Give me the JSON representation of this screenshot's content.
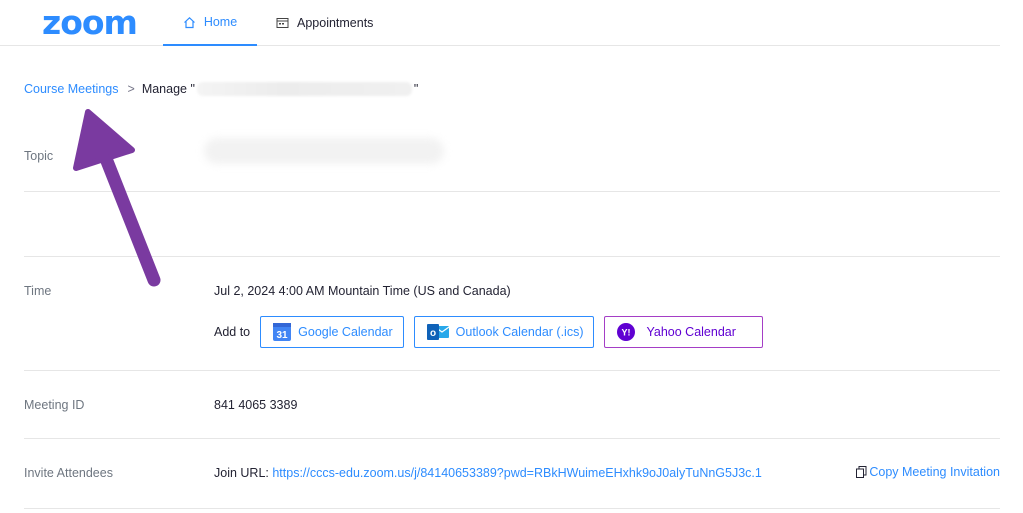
{
  "nav": {
    "logo": "zoom",
    "home": "Home",
    "appointments": "Appointments"
  },
  "breadcrumb": {
    "parent": "Course Meetings",
    "separator": ">",
    "current_prefix": "Manage \"",
    "current_suffix": "\""
  },
  "topic": {
    "label": "Topic"
  },
  "time": {
    "label": "Time",
    "value": "Jul 2, 2024 4:00 AM  Mountain Time (US and Canada)",
    "add_to": "Add to",
    "google": "Google Calendar",
    "google_icon_text": "31",
    "outlook": "Outlook Calendar (.ics)",
    "outlook_icon_text": "o",
    "yahoo": "Yahoo Calendar",
    "yahoo_icon_text": "Y!"
  },
  "meeting_id": {
    "label": "Meeting ID",
    "value": "841 4065 3389"
  },
  "invite": {
    "label": "Invite Attendees",
    "join_label": "Join URL: ",
    "join_url": "https://cccs-edu.zoom.us/j/84140653389?pwd=RBkHWuimeEHxhk9oJ0alyTuNnG5J3c.1",
    "copy": "Copy Meeting Invitation"
  },
  "colors": {
    "accent": "#2d8cff",
    "annotation_arrow": "#7a3aa0",
    "yahoo": "#6001d2"
  },
  "icons": [
    "home-icon",
    "calendar-icon",
    "google-calendar-icon",
    "outlook-icon",
    "yahoo-icon",
    "copy-icon"
  ]
}
